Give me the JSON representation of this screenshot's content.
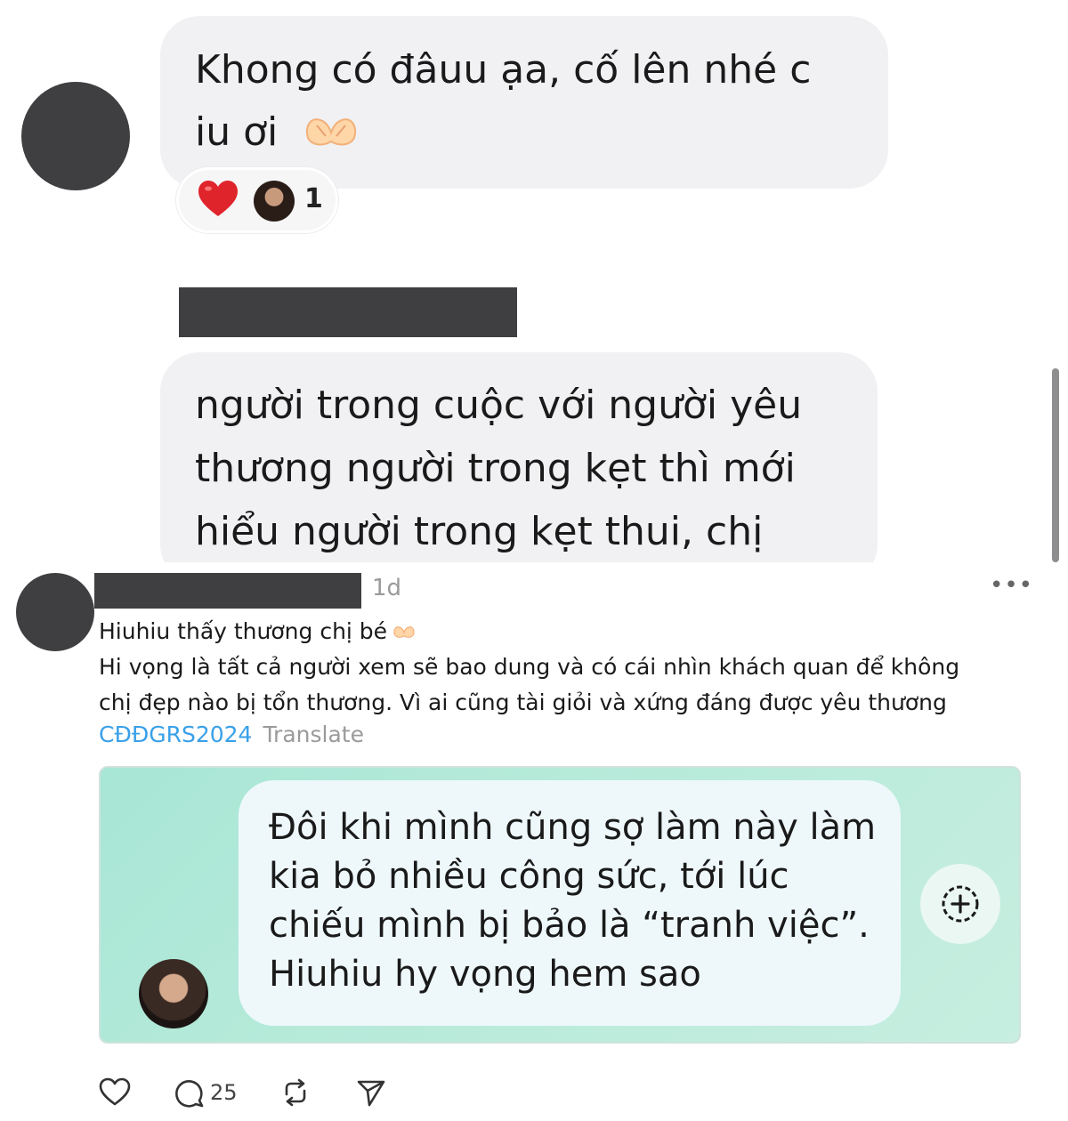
{
  "chat": {
    "bubble1_lines": [
      "Khong có đâuu ạa, cố lên nhé c",
      "iu ơi"
    ],
    "reaction": {
      "emoji": "heart-icon",
      "count": "1",
      "color": "#e0242b"
    },
    "bubble2_lines": [
      "người trong cuộc với người yêu",
      "thương người trong kẹt thì mới",
      "hiểu người trong kẹt thui, chị"
    ]
  },
  "post": {
    "time": "1d",
    "more_label": "•••",
    "lines": [
      "Hiuhiu thấy thương chị bé",
      "Hi vọng là tất cả người xem sẽ bao dung và có cái nhìn khách quan để không",
      "chị đẹp nào bị tổn thương. Vì ai cũng tài giỏi và xứng đáng được yêu thương"
    ],
    "hashtag": "CĐĐGRS2024",
    "translate_label": "Translate",
    "media": {
      "lines": [
        "Đôi khi mình cũng sợ làm này làm",
        "kia bỏ nhiều công sức, tới lúc",
        "chiếu mình bị bảo là “tranh việc”.",
        "Hiuhiu hy vọng hem sao"
      ],
      "background": "#b6ead9"
    },
    "actions": {
      "like_icon": "heart-outline-icon",
      "reply_icon": "comment-icon",
      "reply_count": "25",
      "repost_icon": "repost-icon",
      "share_icon": "send-icon"
    }
  }
}
